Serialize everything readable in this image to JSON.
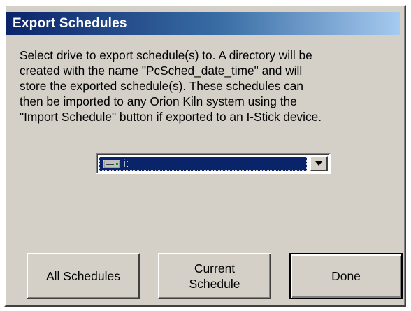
{
  "dialog": {
    "title": "Export Schedules",
    "message": "Select drive to export schedule(s) to. A directory will be\ncreated with the name \"PcSched_date_time\" and will\nstore the exported schedule(s). These schedules can\nthen be imported to any Orion Kiln system using the\n\"Import Schedule\" button if exported to an I-Stick device."
  },
  "drive_select": {
    "selected_value": "i:",
    "icon": "removable-drive-icon"
  },
  "buttons": {
    "all_schedules": "All Schedules",
    "current_schedule": "Current\nSchedule",
    "done": "Done"
  },
  "colors": {
    "title_gradient_start": "#0a246a",
    "title_gradient_end": "#a6caf0",
    "dialog_background": "#d4d0c8",
    "selection_background": "#0a246a"
  }
}
